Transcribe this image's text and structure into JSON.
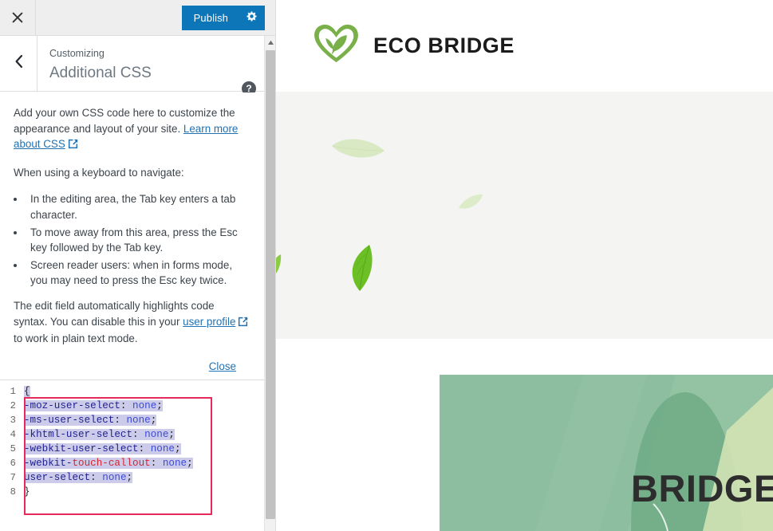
{
  "customizer": {
    "close_button": {
      "label": "Close customizer",
      "icon": "close-icon"
    },
    "publish": {
      "label": "Publish",
      "gear_icon": "gear-icon"
    },
    "back_button": {
      "icon": "chevron-left-icon"
    },
    "eyebrow": "Customizing",
    "title": "Additional CSS",
    "help_icon": "?",
    "help": {
      "intro_before_link": "Add your own CSS code here to customize the appearance and layout of your site. ",
      "intro_link": "Learn more about CSS",
      "keyboard_heading": "When using a keyboard to navigate:",
      "bullets": [
        "In the editing area, the Tab key enters a tab character.",
        "To move away from this area, press the Esc key followed by the Tab key.",
        "Screen reader users: when in forms mode, you may need to press the Esc key twice."
      ],
      "syntax_before_link": "The edit field automatically highlights code syntax. You can disable this in your ",
      "syntax_link": "user profile",
      "syntax_after_link": " to work in plain text mode.",
      "close_label": "Close"
    },
    "editor": {
      "selection_color": "#ccccea",
      "highlight_box_color": "#e8295c",
      "lines": [
        {
          "n": "1",
          "tokens": [
            {
              "t": "{",
              "c": "tok-brace",
              "sel": true
            }
          ]
        },
        {
          "n": "2",
          "tokens": [
            {
              "t": "-moz-user-select",
              "c": "tok-prop",
              "sel": true
            },
            {
              "t": ": ",
              "c": "tok-punct",
              "sel": true
            },
            {
              "t": "none",
              "c": "tok-val",
              "sel": true
            },
            {
              "t": ";",
              "c": "tok-punct",
              "sel": true
            }
          ]
        },
        {
          "n": "3",
          "tokens": [
            {
              "t": "-ms-user-select",
              "c": "tok-prop",
              "sel": true
            },
            {
              "t": ": ",
              "c": "tok-punct",
              "sel": true
            },
            {
              "t": "none",
              "c": "tok-val",
              "sel": true
            },
            {
              "t": ";",
              "c": "tok-punct",
              "sel": true
            }
          ]
        },
        {
          "n": "4",
          "tokens": [
            {
              "t": "-khtml-user-select",
              "c": "tok-prop",
              "sel": true
            },
            {
              "t": ": ",
              "c": "tok-punct",
              "sel": true
            },
            {
              "t": "none",
              "c": "tok-val",
              "sel": true
            },
            {
              "t": ";",
              "c": "tok-punct",
              "sel": true
            }
          ]
        },
        {
          "n": "5",
          "tokens": [
            {
              "t": "-webkit-user-select",
              "c": "tok-prop",
              "sel": true
            },
            {
              "t": ": ",
              "c": "tok-punct",
              "sel": true
            },
            {
              "t": "none",
              "c": "tok-val",
              "sel": true
            },
            {
              "t": ";",
              "c": "tok-punct",
              "sel": true
            }
          ]
        },
        {
          "n": "6",
          "tokens": [
            {
              "t": "-webkit-",
              "c": "tok-prop",
              "sel": true
            },
            {
              "t": "touch-callout",
              "c": "tok-prop-red",
              "sel": true
            },
            {
              "t": ": ",
              "c": "tok-punct",
              "sel": true
            },
            {
              "t": "none",
              "c": "tok-val",
              "sel": true
            },
            {
              "t": ";",
              "c": "tok-punct",
              "sel": true
            }
          ]
        },
        {
          "n": "7",
          "tokens": [
            {
              "t": "user-select",
              "c": "tok-prop",
              "sel": true
            },
            {
              "t": ": ",
              "c": "tok-punct",
              "sel": true
            },
            {
              "t": "none",
              "c": "tok-val",
              "sel": true
            },
            {
              "t": ";",
              "c": "tok-punct",
              "sel": true
            }
          ]
        },
        {
          "n": "8",
          "tokens": [
            {
              "t": "}",
              "c": "tok-brace",
              "sel": false
            }
          ]
        }
      ]
    }
  },
  "preview": {
    "logo": {
      "icon": "heart-leaf-logo-icon",
      "color": "#7ab04a"
    },
    "site_title": "ECO BRIDGE",
    "hero_background": "#f4f4f2",
    "leaves": [
      {
        "name": "leaf-pale-large",
        "color": "#d9e9c4"
      },
      {
        "name": "leaf-pale-small",
        "color": "#dcecc8"
      },
      {
        "name": "leaf-bright",
        "color": "#6cc026"
      },
      {
        "name": "leaf-edge",
        "color": "#8ccc44"
      }
    ],
    "banner": {
      "heading": "BRIDGE",
      "background": "#8cbe9f",
      "text_color": "#2d2d2d"
    }
  }
}
